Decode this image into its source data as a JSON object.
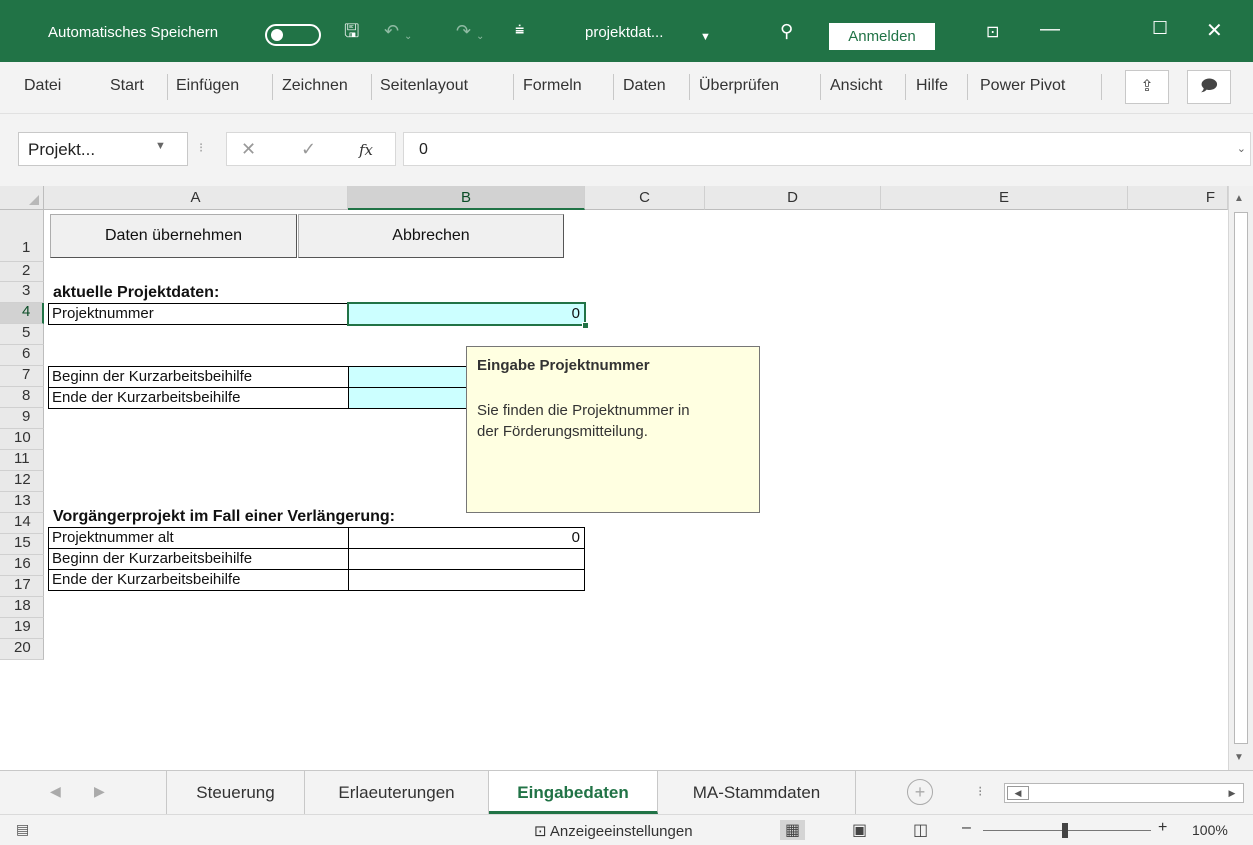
{
  "titlebar": {
    "autosave_label": "Automatisches Speichern",
    "filename": "projektdat...",
    "signin_label": "Anmelden",
    "accent_color": "#217346"
  },
  "ribbon": {
    "tabs": [
      "Datei",
      "Start",
      "Einfügen",
      "Zeichnen",
      "Seitenlayout",
      "Formeln",
      "Daten",
      "Überprüfen",
      "Ansicht",
      "Hilfe",
      "Power Pivot"
    ]
  },
  "formula_bar": {
    "name_box": "Projekt...",
    "fx_label": "fx",
    "value": "0"
  },
  "columns": [
    "A",
    "B",
    "C",
    "D",
    "E",
    "F"
  ],
  "selected_column": "B",
  "rows": [
    "1",
    "2",
    "3",
    "4",
    "5",
    "6",
    "7",
    "8",
    "9",
    "10",
    "11",
    "12",
    "13",
    "14",
    "15",
    "16",
    "17",
    "18",
    "19",
    "20"
  ],
  "selected_row": "4",
  "buttons": {
    "apply": "Daten übernehmen",
    "cancel": "Abbrechen"
  },
  "sheet": {
    "section1_heading": "aktuelle Projektdaten:",
    "project_number_label": "Projektnummer",
    "project_number_value": "0",
    "start_label": "Beginn der Kurzarbeitsbeihilfe",
    "end_label": "Ende der Kurzarbeitsbeihilfe",
    "section2_heading": "Vorgängerprojekt im Fall einer Verlängerung:",
    "old_project_number_label": "Projektnummer alt",
    "old_project_number_value": "0",
    "old_start_label": "Beginn der Kurzarbeitsbeihilfe",
    "old_end_label": "Ende der Kurzarbeitsbeihilfe"
  },
  "tooltip": {
    "title": "Eingabe Projektnummer",
    "body_line1": "Sie finden die Projektnummer in",
    "body_line2": "der Förderungsmitteilung."
  },
  "sheet_tabs": [
    "Steuerung",
    "Erlaeuterungen",
    "Eingabedaten",
    "MA-Stammdaten"
  ],
  "active_sheet": "Eingabedaten",
  "status": {
    "display_settings": "Anzeigeeinstellungen",
    "zoom": "100%"
  }
}
